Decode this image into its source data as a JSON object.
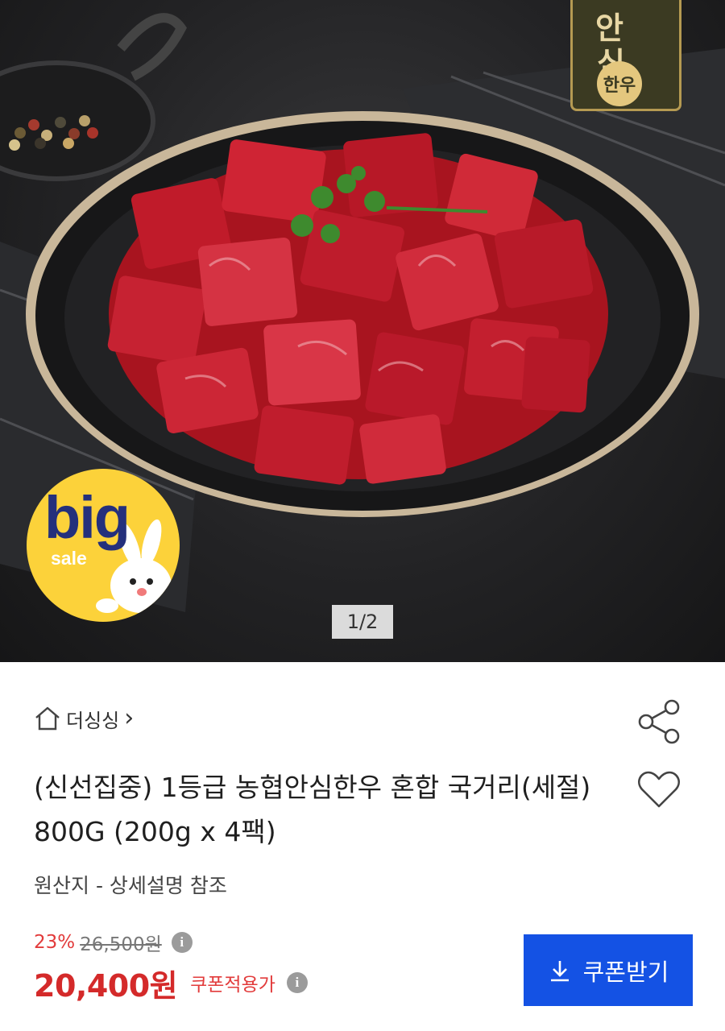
{
  "hero": {
    "counter": "1/2",
    "badge": {
      "big": "big",
      "sale": "sale"
    },
    "brand": {
      "line1": "안",
      "line2": "심",
      "circle": "한우"
    }
  },
  "seller": {
    "name": "더싱싱",
    "chevron": "›"
  },
  "product": {
    "title": "(신선집중) 1등급 농협안심한우 혼합 국거리(세절) 800G (200g x 4팩)",
    "origin": "원산지 - 상세설명 참조"
  },
  "price": {
    "discount": "23%",
    "original": "26,500원",
    "sale": "20,400원",
    "coupon_label": "쿠폰적용가",
    "info_glyph": "i"
  },
  "coupon_button": {
    "label": "쿠폰받기",
    "icon": "download-arrow-icon"
  },
  "colors": {
    "accent_blue": "#1452e4",
    "price_red": "#d42a2a",
    "badge_yellow": "#fcd23a"
  }
}
